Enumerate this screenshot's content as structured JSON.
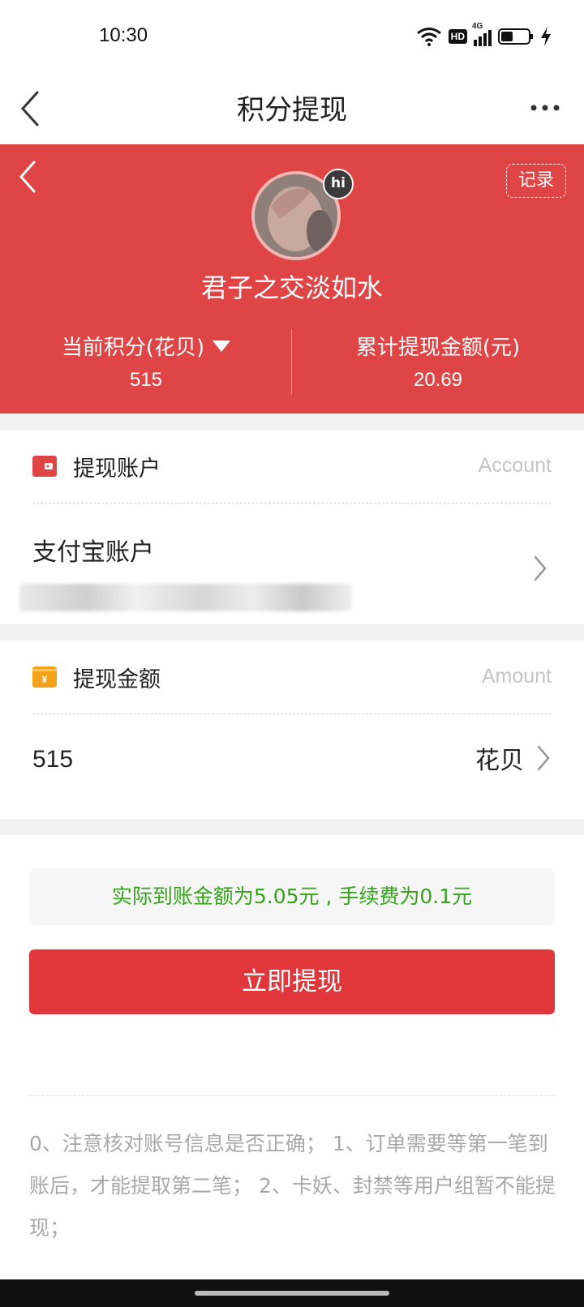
{
  "status_bar": {
    "time": "10:30",
    "hd_label": "HD",
    "network_label": "4G"
  },
  "nav": {
    "title": "积分提现"
  },
  "header": {
    "record_label": "记录",
    "avatar_badge": "hi",
    "username": "君子之交淡如水",
    "points_label": "当前积分(花贝)",
    "points_value": "515",
    "total_label": "累计提现金额(元)",
    "total_value": "20.69"
  },
  "account_card": {
    "title": "提现账户",
    "title_en": "Account",
    "account_type": "支付宝账户"
  },
  "amount_card": {
    "title": "提现金额",
    "title_en": "Amount",
    "amount_value": "515",
    "unit": "花贝"
  },
  "fee_notice": "实际到账金额为5.05元 , 手续费为0.1元",
  "submit_label": "立即提现",
  "notes": "0、注意核对账号信息是否正确； 1、订单需要等第一笔到账后，才能提取第二笔； 2、卡妖、封禁等用户组暂不能提现；",
  "colors": {
    "header_red": "#e04546",
    "button_red": "#e1363a",
    "notice_green": "#34a31a"
  }
}
